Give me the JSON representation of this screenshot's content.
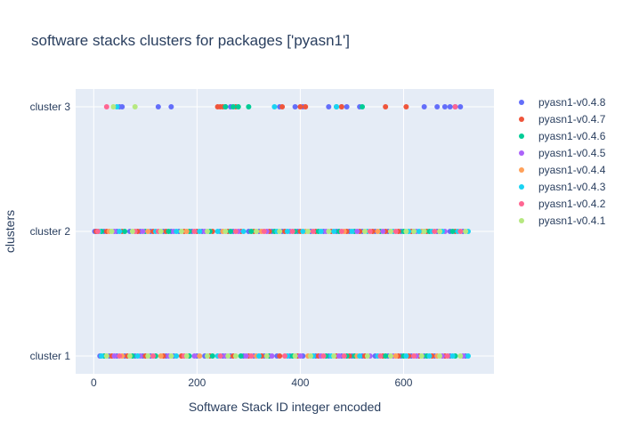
{
  "chart_data": {
    "type": "scatter",
    "title": "software stacks clusters for packages ['pyasn1']",
    "xlabel": "Software Stack ID integer encoded",
    "ylabel": "clusters",
    "xlim": [
      -35,
      775
    ],
    "x_ticks": [
      0,
      200,
      400,
      600
    ],
    "categories": [
      "cluster 1",
      "cluster 2",
      "cluster 3"
    ],
    "grid": true,
    "legend_position": "right",
    "series": [
      {
        "name": "pyasn1-v0.4.8",
        "color": "#636efa",
        "cluster3": [
          50,
          55,
          125,
          150,
          255,
          265,
          360,
          390,
          405,
          455,
          480,
          490,
          515,
          640,
          665,
          680,
          690,
          700,
          710
        ],
        "cluster2": [
          2,
          20,
          45,
          70,
          90,
          110,
          135,
          150,
          165,
          190,
          210,
          245,
          270,
          300,
          320,
          345,
          365,
          395,
          420,
          445,
          470,
          495,
          520,
          545,
          570,
          595,
          620,
          640,
          665,
          690,
          715
        ],
        "cluster1": [
          12,
          30,
          45,
          60,
          80,
          95,
          110,
          140,
          155,
          200,
          215,
          250,
          265,
          290,
          310,
          330,
          355,
          380,
          405,
          430,
          455,
          480,
          500,
          520,
          545,
          570,
          595,
          615,
          640,
          660,
          690,
          720
        ]
      },
      {
        "name": "pyasn1-v0.4.7",
        "color": "#ef553b",
        "cluster3": [
          240,
          245,
          250,
          275,
          365,
          400,
          410,
          480,
          565,
          605
        ],
        "cluster2": [
          5,
          25,
          55,
          85,
          115,
          140,
          175,
          200,
          230,
          260,
          285,
          310,
          340,
          370,
          400,
          430,
          460,
          490,
          515,
          540,
          565,
          590,
          615,
          645,
          670,
          700
        ],
        "cluster1": [
          35,
          65,
          100,
          135,
          170,
          225,
          270,
          300,
          325,
          360,
          395,
          435,
          470,
          495,
          525,
          560,
          590,
          610,
          630,
          655,
          680
        ]
      },
      {
        "name": "pyasn1-v0.4.6",
        "color": "#00cc96",
        "cluster3": [
          255,
          270,
          280,
          300,
          470,
          520
        ],
        "cluster2": [
          15,
          60,
          100,
          145,
          185,
          225,
          265,
          305,
          350,
          390,
          435,
          475,
          505,
          555,
          600,
          650,
          695
        ],
        "cluster1": [
          20,
          75,
          120,
          185,
          230,
          285,
          340,
          385,
          450,
          490,
          505,
          565,
          600,
          645,
          700
        ]
      },
      {
        "name": "pyasn1-v0.4.5",
        "color": "#ab63fa",
        "cluster3": [],
        "cluster2": [
          40,
          95,
          155,
          215,
          280,
          335,
          380,
          450,
          510,
          560,
          625,
          680
        ],
        "cluster1": [
          40,
          90,
          145,
          195,
          255,
          295,
          345,
          400,
          440,
          475,
          535,
          580,
          625,
          675,
          715
        ]
      },
      {
        "name": "pyasn1-v0.4.4",
        "color": "#ffa15a",
        "cluster3": [],
        "cluster2": [
          30,
          105,
          180,
          250,
          325,
          410,
          485,
          550,
          635
        ],
        "cluster1": [
          55,
          130,
          205,
          315,
          415,
          510,
          585,
          665
        ]
      },
      {
        "name": "pyasn1-v0.4.3",
        "color": "#19d3f3",
        "cluster3": [
          45,
          350,
          470
        ],
        "cluster2": [
          10,
          50,
          120,
          160,
          205,
          240,
          290,
          355,
          375,
          405,
          440,
          465,
          500,
          530,
          580,
          610,
          630,
          655,
          675,
          705,
          725
        ],
        "cluster1": [
          15,
          85,
          160,
          240,
          320,
          375,
          425,
          460,
          515,
          550,
          605,
          650,
          695,
          725
        ]
      },
      {
        "name": "pyasn1-v0.4.2",
        "color": "#ff6692",
        "cluster3": [
          25,
          700
        ],
        "cluster2": [
          8,
          80,
          125,
          195,
          275,
          330,
          385,
          425,
          480,
          535,
          585,
          660,
          710
        ],
        "cluster1": [
          50,
          115,
          175,
          245,
          305,
          370,
          445,
          485,
          555,
          620,
          685
        ]
      },
      {
        "name": "pyasn1-v0.4.1",
        "color": "#b6e880",
        "cluster3": [
          38,
          80
        ],
        "cluster2": [
          35,
          75,
          130,
          170,
          220,
          255,
          315,
          360,
          415,
          455,
          525,
          575,
          605,
          620,
          640,
          670,
          720
        ],
        "cluster1": [
          25,
          70,
          105,
          150,
          180,
          220,
          260,
          275,
          335,
          390,
          420,
          465,
          530,
          575,
          635,
          670,
          710
        ]
      }
    ]
  }
}
